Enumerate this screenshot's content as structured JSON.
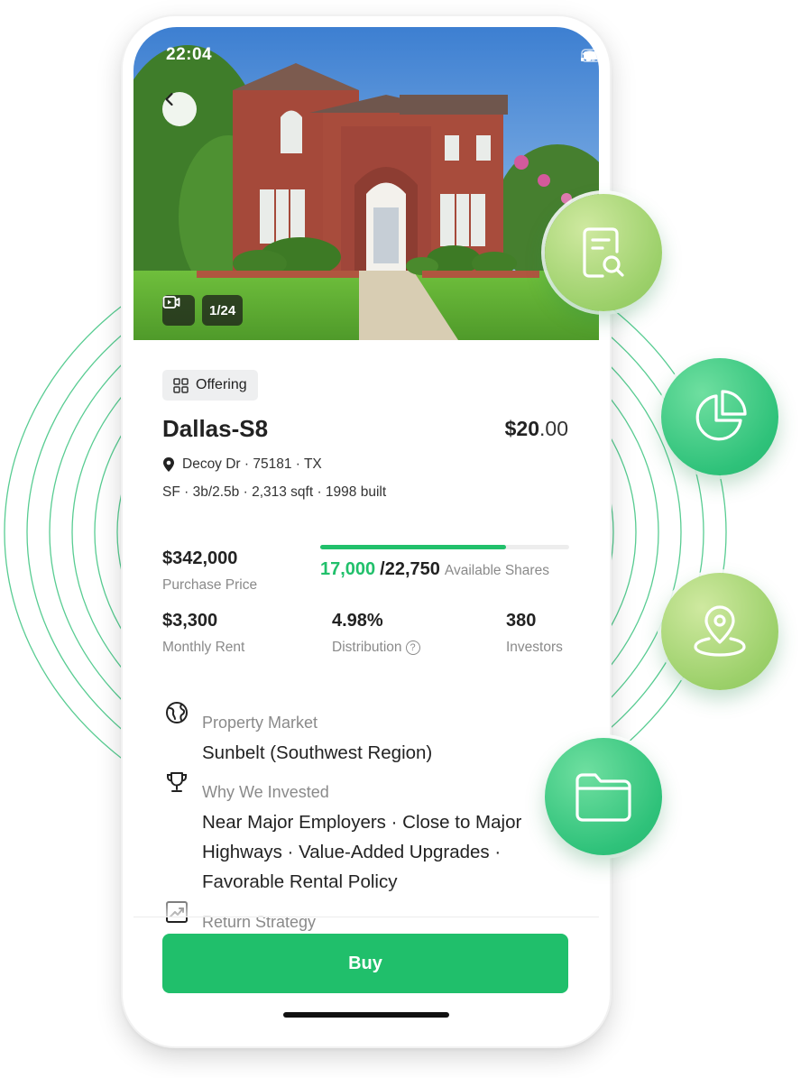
{
  "status_bar": {
    "time": "22:04"
  },
  "gallery": {
    "counter": "1/24"
  },
  "tag": {
    "label": "Offering"
  },
  "property": {
    "name": "Dallas-S8",
    "price_whole": "$20",
    "price_cents": ".00",
    "address": "Decoy Dr · 75181 · TX",
    "specs": "SF · 3b/2.5b · 2,313 sqft · 1998 built"
  },
  "stats": {
    "purchase_price": {
      "value": "$342,000",
      "label": "Purchase Price"
    },
    "shares": {
      "sold": "17,000",
      "total": "/22,750",
      "label": "Available Shares",
      "progress_fraction": 0.747
    },
    "monthly_rent": {
      "value": "$3,300",
      "label": "Monthly Rent"
    },
    "distribution": {
      "value": "4.98%",
      "label": "Distribution",
      "help": "?"
    },
    "investors": {
      "value": "380",
      "label": "Investors"
    }
  },
  "details": {
    "market": {
      "label": "Property Market",
      "value": "Sunbelt (Southwest Region)"
    },
    "why": {
      "label": "Why We Invested",
      "value": "Near Major Employers · Close to Major Highways · Value-Added Upgrades · Favorable Rental Policy"
    },
    "strategy": {
      "label": "Return Strategy"
    }
  },
  "actions": {
    "buy": "Buy"
  },
  "badges": [
    "document-search-icon",
    "pie-chart-icon",
    "location-pin-icon",
    "folder-icon"
  ],
  "colors": {
    "accent": "#20bf6b",
    "lime": "#a5d672",
    "ring": "#3cc47f"
  }
}
